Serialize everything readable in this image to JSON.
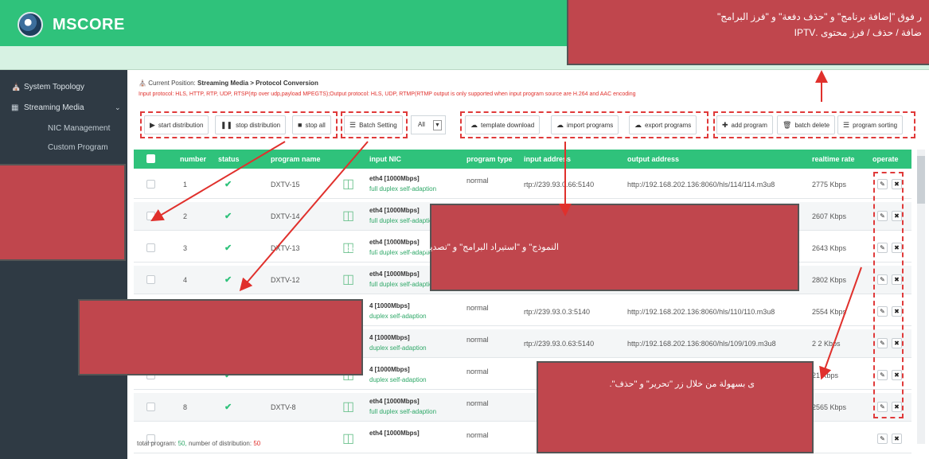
{
  "app": {
    "title": "MSCORE"
  },
  "sidebar": {
    "items": [
      {
        "icon": "home-icon",
        "label": "System Topology"
      },
      {
        "icon": "grid-icon",
        "label": "Streaming Media"
      }
    ],
    "subitems": [
      "NIC Management",
      "Custom Program"
    ]
  },
  "breadcrumb": {
    "prefix": "Current Position:",
    "path": "Streaming Media > Protocol Conversion"
  },
  "protocol_note": "Input protocol: HLS, HTTP, RTP, UDP, RTSP(rtp over udp,payload MPEGTS);Output protocol: HLS, UDP, RTMP(RTMP output is only supported when input program source are H.264 and AAC encoding",
  "toolbar": {
    "start": "start distribution",
    "stop": "stop distribution",
    "stop_all": "stop all",
    "batch_setting": "Batch Setting",
    "select_value": "All",
    "template_download": "template download",
    "import_programs": "import programs",
    "export_programs": "export programs",
    "add_program": "add program",
    "batch_delete": "batch delete",
    "program_sorting": "program sorting"
  },
  "table": {
    "headers": {
      "number": "number",
      "status": "status",
      "program_name": "program name",
      "input_nic": "input NIC",
      "program_type": "program type",
      "input_address": "input address",
      "output_address": "output address",
      "realtime_rate": "realtime rate",
      "operate": "operate"
    },
    "rows": [
      {
        "number": "1",
        "name": "DXTV-15",
        "nic": "eth4 [1000Mbps]",
        "duplex": "full duplex self-adaption",
        "type": "normal",
        "input": "rtp://239.93.0.66:5140",
        "output": "http://192.168.202.136:8060/hls/114/114.m3u8",
        "rate": "2775 Kbps"
      },
      {
        "number": "2",
        "name": "DXTV-14",
        "nic": "eth4 [1000Mbps]",
        "duplex": "full duplex self-adaption",
        "type": "normal",
        "input": "",
        "output": "",
        "rate": "2607 Kbps"
      },
      {
        "number": "3",
        "name": "DXTV-13",
        "nic": "eth4 [1000Mbps]",
        "duplex": "full duplex self-adaption",
        "type": "",
        "input": "",
        "output": "",
        "rate": "2643 Kbps"
      },
      {
        "number": "4",
        "name": "DXTV-12",
        "nic": "eth4 [1000Mbps]",
        "duplex": "full duplex self-adaption",
        "type": "",
        "input": "",
        "output": "",
        "rate": "2802 Kbps"
      },
      {
        "number": "",
        "name": "",
        "nic": "4 [1000Mbps]",
        "duplex": "duplex self-adaption",
        "type": "normal",
        "input": "rtp://239.93.0.3:5140",
        "output": "http://192.168.202.136:8060/hls/110/110.m3u8",
        "rate": "2554 Kbps"
      },
      {
        "number": "",
        "name": "",
        "nic": "4 [1000Mbps]",
        "duplex": "duplex self-adaption",
        "type": "normal",
        "input": "rtp://239.93.0.63:5140",
        "output": "http://192.168.202.136:8060/hls/109/109.m3u8",
        "rate": "2 2 Kbps"
      },
      {
        "number": "",
        "name": "",
        "nic": "4 [1000Mbps]",
        "duplex": "duplex self-adaption",
        "type": "normal",
        "input": "",
        "output": "",
        "rate": "21 Kbps"
      },
      {
        "number": "8",
        "name": "DXTV-8",
        "nic": "eth4 [1000Mbps]",
        "duplex": "full duplex self-adaption",
        "type": "normal",
        "input": "",
        "output": "",
        "rate": "2565 Kbps"
      },
      {
        "number": "",
        "name": "",
        "nic": "eth4 [1000Mbps]",
        "duplex": "",
        "type": "normal",
        "input": "",
        "output": "",
        "rate": ""
      }
    ]
  },
  "footer": {
    "total_label": "total program:",
    "total_value": "50,",
    "dist_label": "number of distribution:",
    "dist_value": "50"
  },
  "annotations": {
    "top_right_line1": "ر فوق \"إضافة برنامج\" و \"حذف دفعة\" و \"فرز البرامج\"",
    "top_right_line2": "ضافة / حذف / فرز محتوى .IPTV",
    "middle": "النموذج\" و \"استيراد البرامج\" و \"تصدير البرامج\" لإدارة محتوى .IPTV",
    "bottom": "ى بسهولة من خلال زر \"تحرير\" و \"حذف\"."
  },
  "colors": {
    "brand_green": "#2fc27b",
    "sidebar": "#2f3a44",
    "annotation": "#c0464d",
    "dashed": "#e03a3a"
  }
}
